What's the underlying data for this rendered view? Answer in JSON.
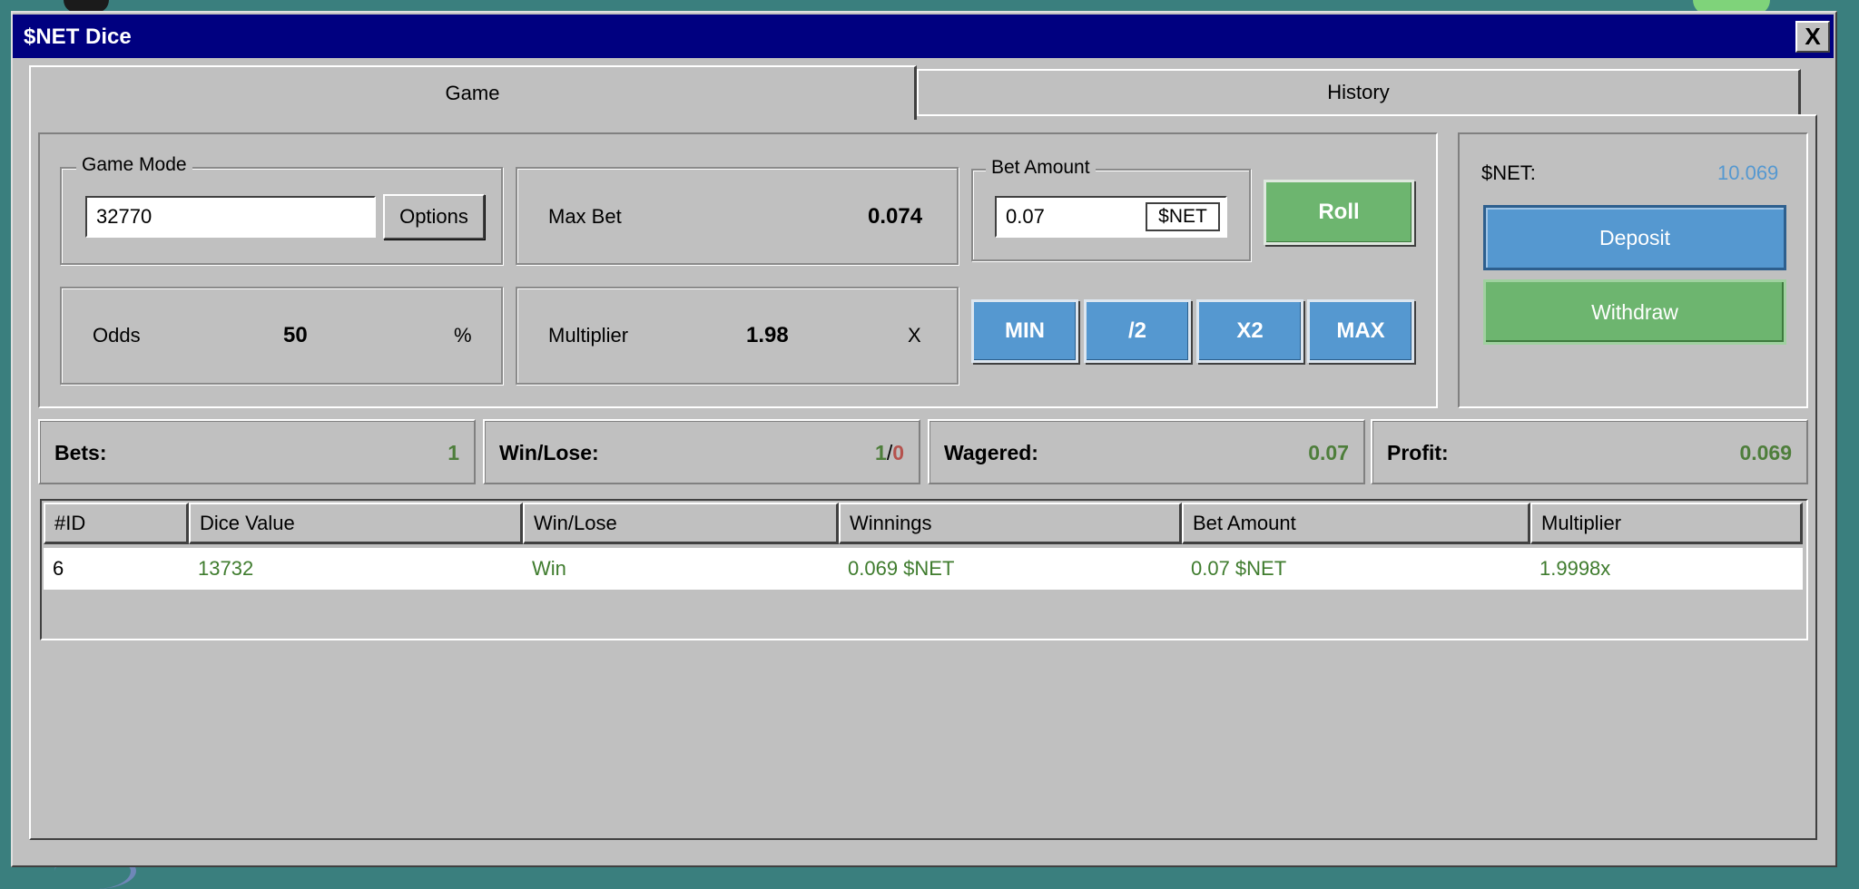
{
  "window": {
    "title": "$NET Dice",
    "close_label": "X"
  },
  "tabs": [
    {
      "label": "Game",
      "active": true
    },
    {
      "label": "History",
      "active": false
    }
  ],
  "game_mode": {
    "legend": "Game Mode",
    "value": "32770",
    "options_label": "Options"
  },
  "max_bet": {
    "label": "Max Bet",
    "value": "0.074"
  },
  "bet_amount": {
    "legend": "Bet Amount",
    "value": "0.07",
    "currency": "$NET"
  },
  "roll_label": "Roll",
  "odds": {
    "label": "Odds",
    "value": "50",
    "unit": "%"
  },
  "multiplier": {
    "label": "Multiplier",
    "value": "1.98",
    "unit": "X"
  },
  "bet_buttons": {
    "min": "MIN",
    "half": "/2",
    "double": "X2",
    "max": "MAX"
  },
  "wallet": {
    "label": "$NET:",
    "balance": "10.069",
    "deposit_label": "Deposit",
    "withdraw_label": "Withdraw"
  },
  "stats": {
    "bets_label": "Bets:",
    "bets_value": "1",
    "winlose_label": "Win/Lose:",
    "wins": "1",
    "sep": "/",
    "losses": "0",
    "wagered_label": "Wagered:",
    "wagered_value": "0.07",
    "profit_label": "Profit:",
    "profit_value": "0.069"
  },
  "table": {
    "columns": [
      "#ID",
      "Dice Value",
      "Win/Lose",
      "Winnings",
      "Bet Amount",
      "Multiplier"
    ],
    "rows": [
      {
        "id": "6",
        "dice": "13732",
        "result": "Win",
        "winnings": "0.069 $NET",
        "bet": "0.07 $NET",
        "multiplier": "1.9998x"
      }
    ]
  },
  "colors": {
    "title_bar": "#000080",
    "window_face": "#c0c0c0",
    "desktop": "#3a7f7e",
    "green": "#6db56f",
    "blue": "#5598d0",
    "positive_text": "#4e7e3b",
    "negative_text": "#b5524d",
    "balance_text": "#5598d0"
  }
}
